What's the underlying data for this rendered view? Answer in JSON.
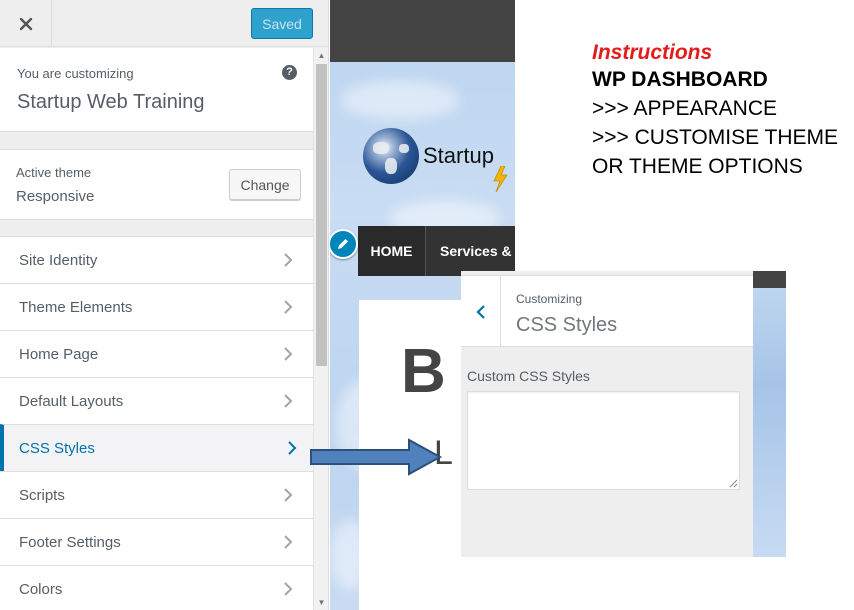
{
  "sidebar": {
    "close_icon": "close-icon",
    "saved_label": "Saved",
    "customizing": {
      "label": "You are customizing",
      "site_title": "Startup Web Training",
      "help_icon": "?"
    },
    "active_theme": {
      "label": "Active theme",
      "name": "Responsive",
      "change_label": "Change"
    },
    "items": [
      {
        "label": "Site Identity",
        "active": false
      },
      {
        "label": "Theme Elements",
        "active": false
      },
      {
        "label": "Home Page",
        "active": false
      },
      {
        "label": "Default Layouts",
        "active": false
      },
      {
        "label": "CSS Styles",
        "active": true
      },
      {
        "label": "Scripts",
        "active": false
      },
      {
        "label": "Footer Settings",
        "active": false
      },
      {
        "label": "Colors",
        "active": false
      }
    ],
    "accent_color": "#0073aa"
  },
  "preview": {
    "logo_text": "Startup",
    "nav": {
      "home": "HOME",
      "services": "Services &"
    },
    "heading_partial": "B",
    "subheading_partial": "L"
  },
  "instructions": {
    "heading": "Instructions",
    "lines": [
      "WP DASHBOARD",
      ">>> APPEARANCE",
      ">>> CUSTOMISE THEME",
      "OR THEME OPTIONS"
    ],
    "heading_color": "#e31b1b"
  },
  "css_panel": {
    "customizing_label": "Customizing",
    "title": "CSS Styles",
    "field_label": "Custom CSS Styles",
    "field_value": ""
  }
}
